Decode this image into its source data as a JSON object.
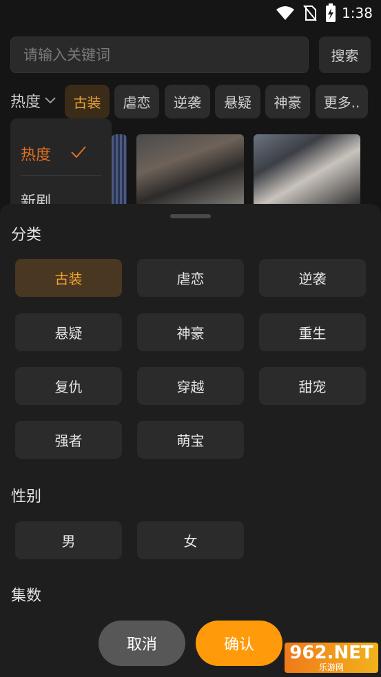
{
  "status": {
    "time": "1:38"
  },
  "search": {
    "placeholder": "请输入关键词",
    "button": "搜索"
  },
  "sort": {
    "label": "热度",
    "options": [
      "热度",
      "新剧"
    ],
    "selected": "热度"
  },
  "top_chips": [
    "古装",
    "虐恋",
    "逆袭",
    "悬疑",
    "神豪",
    "更多.."
  ],
  "top_chip_selected": "古装",
  "sheet": {
    "sections": [
      {
        "title": "分类",
        "options": [
          "古装",
          "虐恋",
          "逆袭",
          "悬疑",
          "神豪",
          "重生",
          "复仇",
          "穿越",
          "甜宠",
          "强者",
          "萌宝"
        ],
        "selected": "古装"
      },
      {
        "title": "性别",
        "options": [
          "男",
          "女"
        ]
      },
      {
        "title": "集数",
        "options": []
      }
    ],
    "cancel": "取消",
    "confirm": "确认"
  },
  "watermark": {
    "main": "962.NET",
    "sub": "乐游网"
  },
  "colors": {
    "accent": "#ff9a0a",
    "active_text": "#f0a42c",
    "sort_active": "#e0701f"
  }
}
